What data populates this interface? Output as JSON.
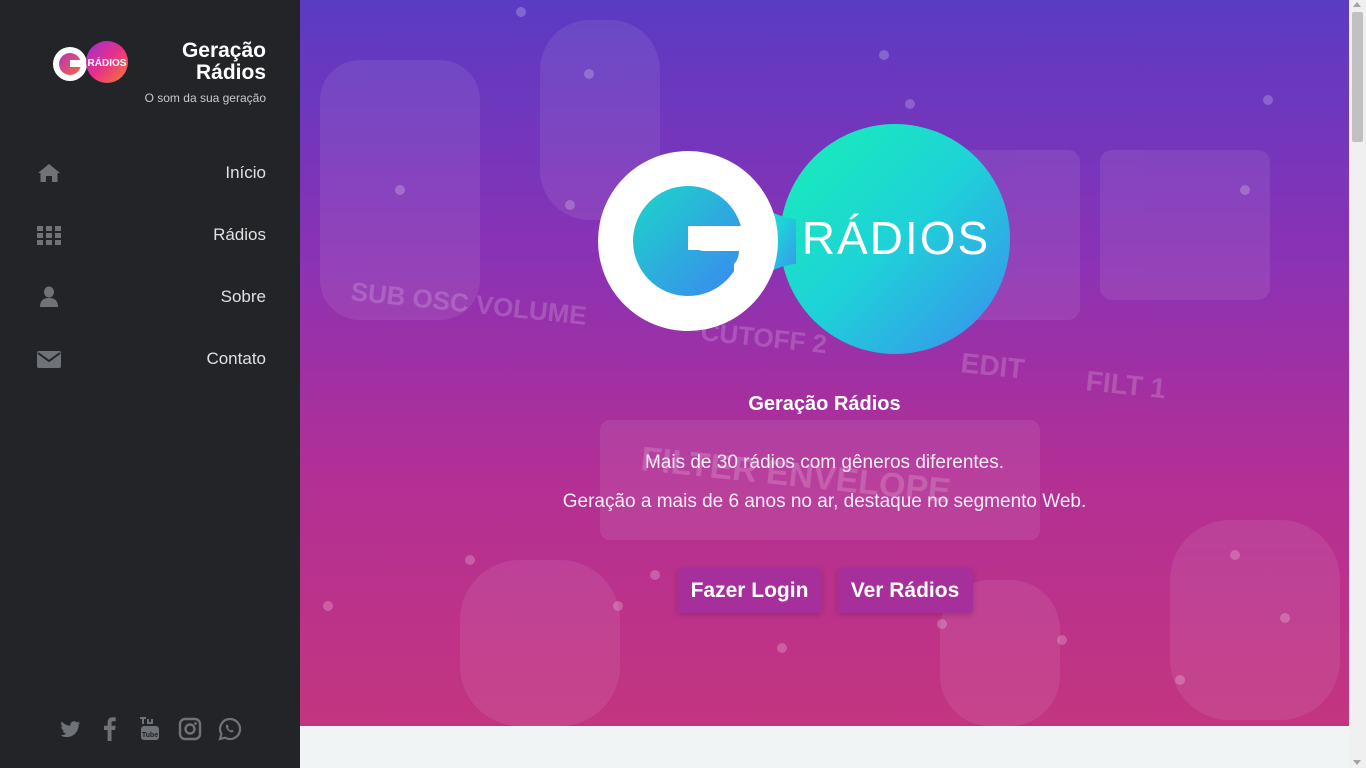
{
  "brand": {
    "title": "Geração Rádios",
    "tagline": "O som da sua geração",
    "logo_text": "RÁDIOS"
  },
  "nav": [
    {
      "label": "Início",
      "icon": "home-icon"
    },
    {
      "label": "Rádios",
      "icon": "grid-icon"
    },
    {
      "label": "Sobre",
      "icon": "user-icon"
    },
    {
      "label": "Contato",
      "icon": "envelope-icon"
    }
  ],
  "social": [
    "twitter-icon",
    "facebook-icon",
    "youtube-icon",
    "instagram-icon",
    "whatsapp-icon"
  ],
  "hero": {
    "logo_text": "RÁDIOS",
    "title": "Geração Rádios",
    "line1": "Mais de 30 rádios com gêneros diferentes.",
    "line2": "Geração a mais de 6 anos no ar, destaque no segmento Web.",
    "login_button": "Fazer Login",
    "radios_button": "Ver Rádios"
  },
  "colors": {
    "sidebar": "#222427",
    "accent_button": "#a72f9b",
    "hero_top": "#5a3bc3",
    "hero_bottom": "#c33580"
  }
}
